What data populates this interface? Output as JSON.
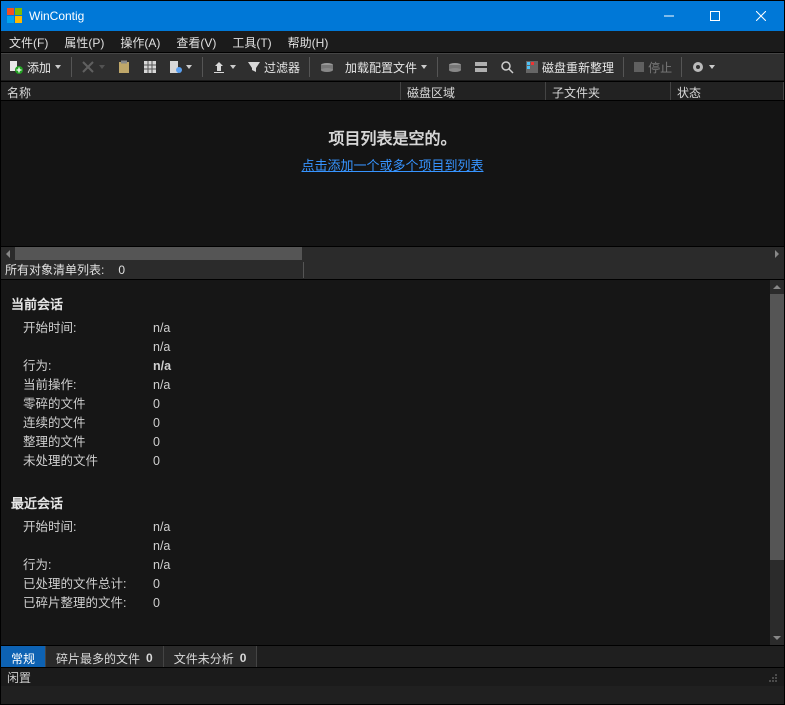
{
  "title": "WinContig",
  "menus": [
    "文件(F)",
    "属性(P)",
    "操作(A)",
    "查看(V)",
    "工具(T)",
    "帮助(H)"
  ],
  "toolbar": {
    "add_label": "添加",
    "filter_label": "过滤器",
    "load_profile_label": "加载配置文件",
    "disk_defrag_label": "磁盘重新整理",
    "stop_label": "停止"
  },
  "columns": {
    "name": "名称",
    "disk_area": "磁盘区域",
    "subfolders": "子文件夹",
    "status": "状态"
  },
  "list_empty": {
    "title": "项目列表是空的。",
    "link": "点击添加一个或多个项目到列表"
  },
  "summary": {
    "label": "所有对象清单列表:",
    "count": "0"
  },
  "sessions": {
    "current": {
      "title": "当前会话",
      "rows": [
        {
          "k": "开始时间:",
          "v": "n/a"
        },
        {
          "k": "",
          "v": "n/a"
        },
        {
          "k": "行为:",
          "v": "n/a",
          "bold": true
        },
        {
          "k": "当前操作:",
          "v": "n/a"
        },
        {
          "k": "零碎的文件",
          "v": "0"
        },
        {
          "k": "连续的文件",
          "v": "0"
        },
        {
          "k": "整理的文件",
          "v": "0"
        },
        {
          "k": "未处理的文件",
          "v": "0"
        }
      ]
    },
    "recent": {
      "title": "最近会话",
      "rows": [
        {
          "k": "开始时间:",
          "v": "n/a"
        },
        {
          "k": "",
          "v": "n/a"
        },
        {
          "k": "行为:",
          "v": "n/a"
        },
        {
          "k": "已处理的文件总计:",
          "v": "0"
        },
        {
          "k": "已碎片整理的文件:",
          "v": "0"
        }
      ]
    }
  },
  "tabs": {
    "general": "常规",
    "most_fragmented": "碎片最多的文件",
    "most_fragmented_count": "0",
    "unanalyzed": "文件未分析",
    "unanalyzed_count": "0"
  },
  "status": {
    "text": "闲置"
  }
}
